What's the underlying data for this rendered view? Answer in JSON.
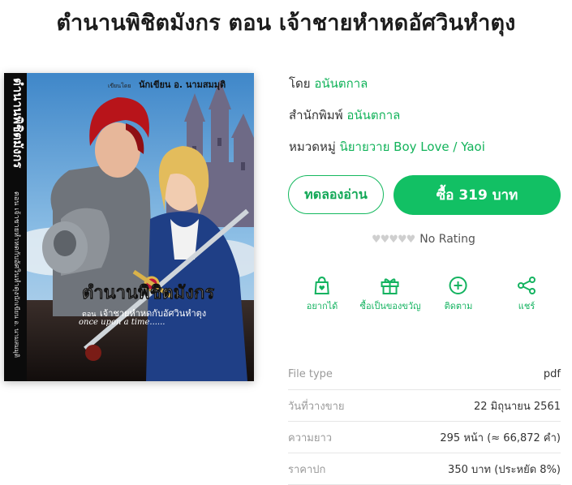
{
  "page_title": "ตำนานพิชิตมังกร ตอน เจ้าชายหำหดอัศวินหำตุง",
  "cover": {
    "author_prefix": "เขียนโดย",
    "author_name": "นักเขียน อ. นามสมมุติ",
    "spine_title": "ตำนานพิชิตมังกร",
    "spine_sub": "ตอน เจ้าชายหำหดกับอัศวินหำตุง",
    "spine_author": "นักเขียน อ. นามสมมุติ",
    "once": "once upon a time......",
    "main_title": "ตำนานพิชิตมังกร",
    "sub_prefix": "ตอน",
    "sub_title": "เจ้าชายหำหดกับอัศวินหำตุง"
  },
  "meta": {
    "author_label": "โดย",
    "author_value": "อนันตกาล",
    "publisher_label": "สำนักพิมพ์",
    "publisher_value": "อนันตกาล",
    "category_label": "หมวดหมู่",
    "category_value": "นิยายวาย Boy Love / Yaoi"
  },
  "buttons": {
    "try_read": "ทดลองอ่าน",
    "buy": "ซื้อ 319 บาท"
  },
  "rating": {
    "hearts": "♥♥♥♥♥",
    "text": "No Rating"
  },
  "actions": [
    {
      "label": "อยากได้",
      "icon": "wishlist-bag-icon"
    },
    {
      "label": "ซื้อเป็นของขวัญ",
      "icon": "gift-icon"
    },
    {
      "label": "ติดตาม",
      "icon": "follow-plus-icon"
    },
    {
      "label": "แชร์",
      "icon": "share-icon"
    }
  ],
  "info": [
    {
      "key": "File type",
      "value": "pdf"
    },
    {
      "key": "วันที่วางขาย",
      "value": "22 มิถุนายน 2561"
    },
    {
      "key": "ความยาว",
      "value": "295 หน้า (≈ 66,872 คำ)"
    },
    {
      "key": "ราคาปก",
      "value": "350 บาท (ประหยัด 8%)"
    }
  ],
  "colors": {
    "accent": "#12c064",
    "accent_text": "#12b35a",
    "muted": "#9a9a9a"
  }
}
